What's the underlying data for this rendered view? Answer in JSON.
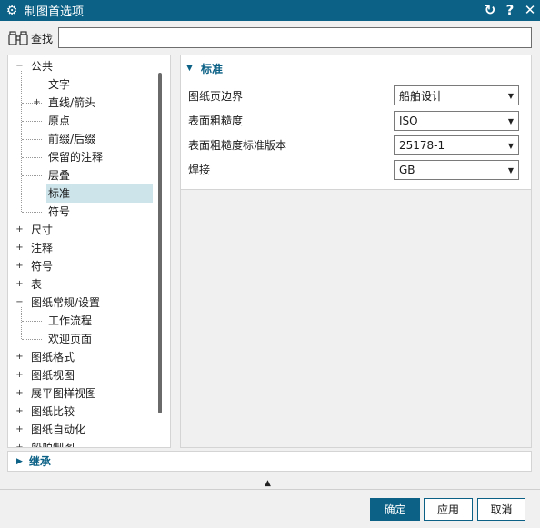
{
  "window": {
    "title": "制图首选项",
    "buttons": {
      "reset": "↻",
      "help": "?",
      "close": "✕"
    }
  },
  "search": {
    "label": "查找",
    "value": "",
    "placeholder": ""
  },
  "tree": [
    {
      "label": "公共",
      "expander": "−",
      "level": 0
    },
    {
      "label": "文字",
      "expander": "",
      "level": 1
    },
    {
      "label": "直线/箭头",
      "expander": "+",
      "level": 1
    },
    {
      "label": "原点",
      "expander": "",
      "level": 1
    },
    {
      "label": "前缀/后缀",
      "expander": "",
      "level": 1
    },
    {
      "label": "保留的注释",
      "expander": "",
      "level": 1
    },
    {
      "label": "层叠",
      "expander": "",
      "level": 1
    },
    {
      "label": "标准",
      "expander": "",
      "level": 1,
      "selected": true
    },
    {
      "label": "符号",
      "expander": "",
      "level": 1
    },
    {
      "label": "尺寸",
      "expander": "+",
      "level": 0
    },
    {
      "label": "注释",
      "expander": "+",
      "level": 0
    },
    {
      "label": "符号",
      "expander": "+",
      "level": 0
    },
    {
      "label": "表",
      "expander": "+",
      "level": 0
    },
    {
      "label": "图纸常规/设置",
      "expander": "−",
      "level": 0
    },
    {
      "label": "工作流程",
      "expander": "",
      "level": 1
    },
    {
      "label": "欢迎页面",
      "expander": "",
      "level": 1
    },
    {
      "label": "图纸格式",
      "expander": "+",
      "level": 0
    },
    {
      "label": "图纸视图",
      "expander": "+",
      "level": 0
    },
    {
      "label": "展平图样视图",
      "expander": "+",
      "level": 0
    },
    {
      "label": "图纸比较",
      "expander": "+",
      "level": 0
    },
    {
      "label": "图纸自动化",
      "expander": "+",
      "level": 0
    },
    {
      "label": "船舶制图",
      "expander": "+",
      "level": 0
    }
  ],
  "section": {
    "title": "标准",
    "properties": [
      {
        "label": "图纸页边界",
        "value": "船舶设计"
      },
      {
        "label": "表面粗糙度",
        "value": "ISO"
      },
      {
        "label": "表面粗糙度标准版本",
        "value": "25178-1"
      },
      {
        "label": "焊接",
        "value": "GB"
      }
    ]
  },
  "inherit": {
    "label": "继承"
  },
  "footer": {
    "ok": "确定",
    "apply": "应用",
    "cancel": "取消"
  },
  "colors": {
    "accent": "#0b6186",
    "selection": "#cde4eb"
  }
}
